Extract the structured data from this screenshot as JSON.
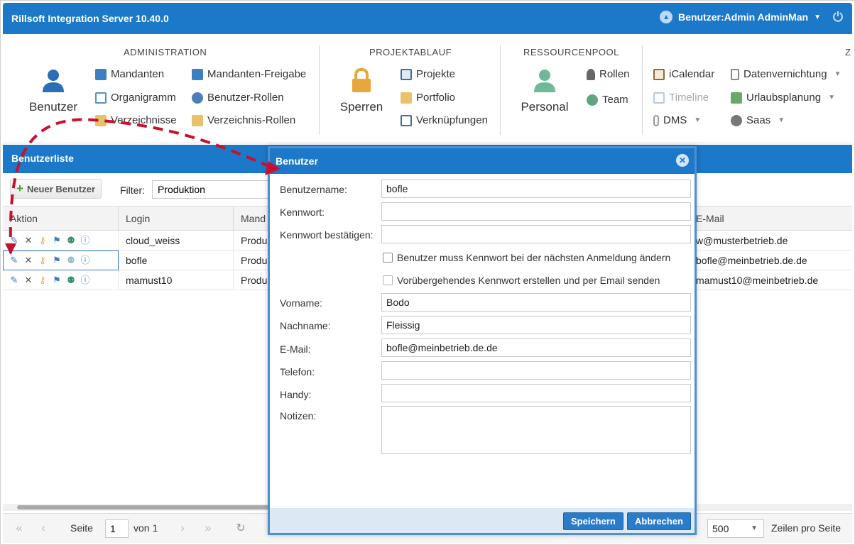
{
  "app": {
    "title": "Rillsoft Integration Server 10.40.0",
    "user": "Benutzer:Admin AdminMan"
  },
  "ribbon": {
    "administration": {
      "title": "ADMINISTRATION",
      "big": "Benutzer",
      "items": [
        "Mandanten",
        "Organigramm",
        "Verzeichnisse",
        "Mandanten-Freigabe",
        "Benutzer-Rollen",
        "Verzeichnis-Rollen"
      ]
    },
    "projektablauf": {
      "title": "PROJEKTABLAUF",
      "big": "Sperren",
      "items": [
        "Projekte",
        "Portfolio",
        "Verknüpfungen"
      ]
    },
    "ressourcenpool": {
      "title": "RESSOURCENPOOL",
      "big": "Personal",
      "items": [
        "Rollen",
        "Team"
      ]
    },
    "extra": {
      "title": "Z",
      "items": [
        "iCalendar",
        "Timeline",
        "DMS",
        "Datenvernichtung",
        "Urlaubsplanung",
        "Saas"
      ]
    }
  },
  "list": {
    "title": "Benutzerliste",
    "new_button": "Neuer Benutzer",
    "filter_label": "Filter:",
    "filter_value": "Produktion",
    "columns": [
      "Aktion",
      "Login",
      "Mand",
      "E-Mail"
    ],
    "rows": [
      {
        "login": "cloud_weiss",
        "mandant": "Produ",
        "email": "w@musterbetrieb.de"
      },
      {
        "login": "bofle",
        "mandant": "Produ",
        "email": "bofle@meinbetrieb.de.de"
      },
      {
        "login": "mamust10",
        "mandant": "Produ",
        "email": "mamust10@meinbetrieb.de"
      }
    ]
  },
  "pager": {
    "page_label": "Seite",
    "page": "1",
    "of": "von 1",
    "per_page": "500",
    "per_page_label": "Zeilen pro Seite"
  },
  "dialog": {
    "title": "Benutzer",
    "labels": {
      "username": "Benutzername:",
      "password": "Kennwort:",
      "password_confirm": "Kennwort bestätigen:",
      "firstname": "Vorname:",
      "lastname": "Nachname:",
      "email": "E-Mail:",
      "phone": "Telefon:",
      "mobile": "Handy:",
      "notes": "Notizen:"
    },
    "values": {
      "username": "bofle",
      "password": "",
      "password_confirm": "",
      "firstname": "Bodo",
      "lastname": "Fleissig",
      "email": "bofle@meinbetrieb.de.de",
      "phone": "",
      "mobile": ""
    },
    "checks": [
      "Benutzer muss Kennwort bei der nächsten Anmeldung ändern",
      "Vorübergehendes Kennwort erstellen und per Email senden"
    ],
    "save": "Speichern",
    "cancel": "Abbrechen"
  },
  "colors": {
    "primary": "#1c78c8",
    "arrow": "#c8102e"
  }
}
